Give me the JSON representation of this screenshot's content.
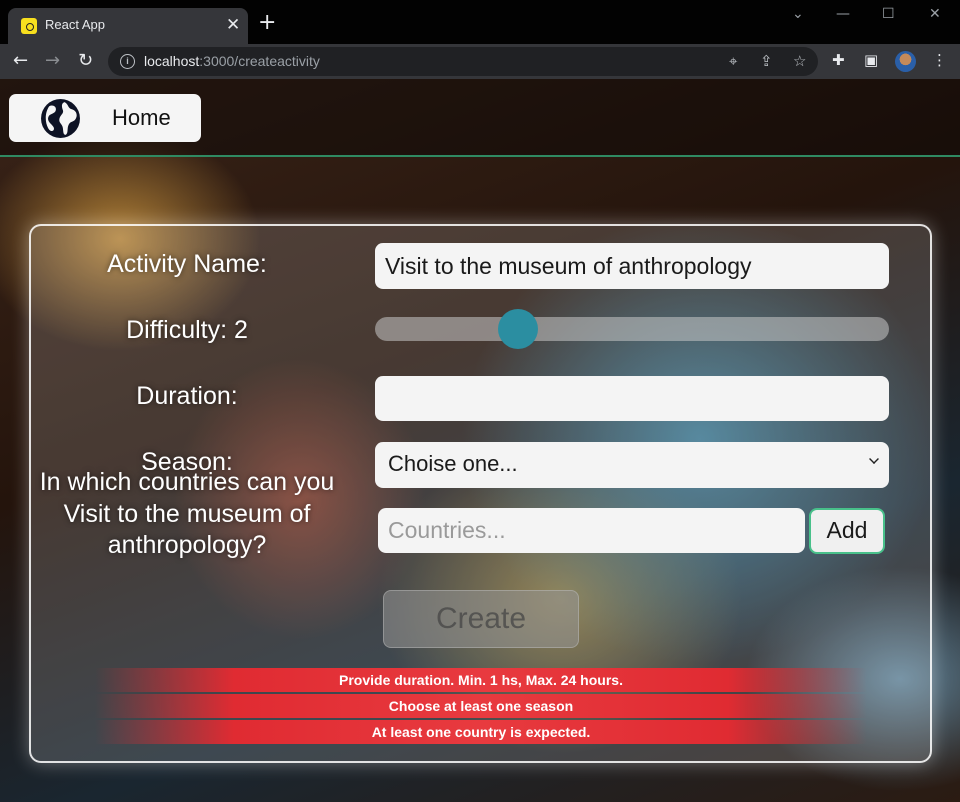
{
  "browser": {
    "tab_title": "React App",
    "tab_close": "✕",
    "new_tab": "+",
    "url_host": "localhost",
    "url_path": ":3000/createactivity",
    "window_controls": [
      "⌄",
      "—",
      "☐",
      "✕"
    ]
  },
  "navbar": {
    "home_label": "Home"
  },
  "form": {
    "activity_name_label": "Activity Name:",
    "activity_name_value": "Visit to the museum of anthropology",
    "difficulty_label": "Difficulty: 2",
    "difficulty_value": 2,
    "duration_label": "Duration:",
    "duration_value": "",
    "season_label": "Season:",
    "season_selected": "Choise one...",
    "countries_question": "In which countries can you Visit to the museum of anthropology?",
    "countries_placeholder": "Countries...",
    "add_label": "Add",
    "create_label": "Create"
  },
  "errors": [
    "Provide duration. Min. 1 hs, Max. 24 hours.",
    "Choose at least one season",
    "At least one country is expected."
  ],
  "colors": {
    "accent_teal": "#2b8ea1",
    "add_border_green": "#48c08a",
    "error_red": "#e02b32"
  }
}
